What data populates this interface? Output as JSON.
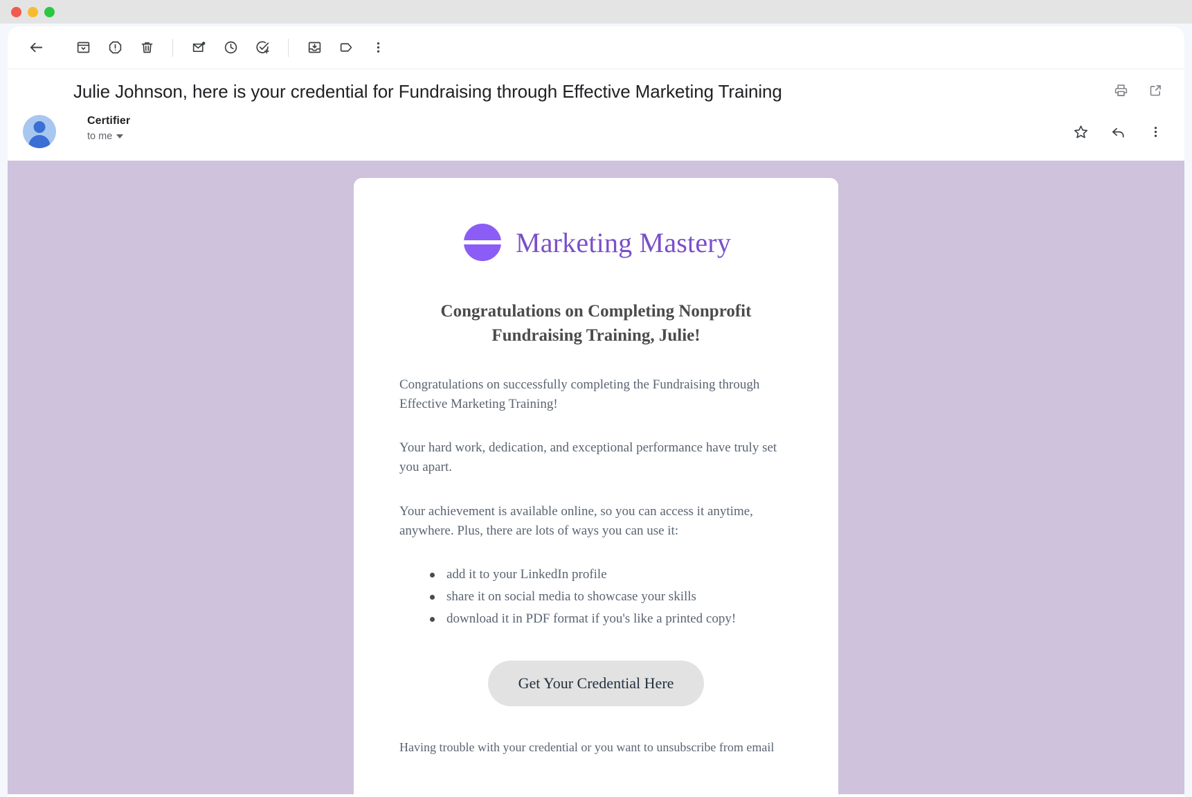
{
  "window": {
    "traffic_lights": [
      {
        "name": "close-button",
        "color": "#f05a4f"
      },
      {
        "name": "minimize-button",
        "color": "#f7bc2e"
      },
      {
        "name": "maximize-button",
        "color": "#28c840"
      }
    ]
  },
  "toolbar": {
    "buttons": [
      {
        "name": "back-to-inbox-button",
        "icon": "arrow-back-icon",
        "label": "Back to inbox"
      },
      {
        "name": "archive-button",
        "icon": "archive-icon",
        "label": "Archive"
      },
      {
        "name": "report-spam-button",
        "icon": "report-spam-icon",
        "label": "Report spam"
      },
      {
        "name": "delete-button",
        "icon": "trash-icon",
        "label": "Delete"
      },
      {
        "name": "mark-unread-button",
        "icon": "mark-unread-icon",
        "label": "Mark as unread"
      },
      {
        "name": "snooze-button",
        "icon": "clock-icon",
        "label": "Snooze"
      },
      {
        "name": "add-to-tasks-button",
        "icon": "add-task-icon",
        "label": "Add to tasks"
      },
      {
        "name": "move-to-button",
        "icon": "move-to-inbox-icon",
        "label": "Move to"
      },
      {
        "name": "labels-button",
        "icon": "label-icon",
        "label": "Labels"
      },
      {
        "name": "more-options-button",
        "icon": "more-vertical-icon",
        "label": "More"
      }
    ]
  },
  "subject": {
    "title": "Julie Johnson, here is your credential for Fundraising through Effective Marketing Training",
    "actions": [
      {
        "name": "print-button",
        "icon": "printer-icon",
        "label": "Print all"
      },
      {
        "name": "open-in-new-window-button",
        "icon": "open-in-new-icon",
        "label": "Open in new window"
      }
    ]
  },
  "message": {
    "sender_name": "Certifier",
    "recipient": "to me",
    "actions": [
      {
        "name": "star-button",
        "icon": "star-outline-icon",
        "label": "Star"
      },
      {
        "name": "reply-button",
        "icon": "reply-icon",
        "label": "Reply"
      },
      {
        "name": "message-more-button",
        "icon": "more-vertical-icon",
        "label": "More"
      }
    ]
  },
  "email": {
    "canvas_color": "#cec2dc",
    "brand": {
      "name": "Marketing Mastery",
      "mark": "purple-circle-logo-icon",
      "color": "#7b4fc9",
      "mark_color": "#8b5cf6"
    },
    "heading": "Congratulations on Completing Nonprofit Fundraising Training, Julie!",
    "paragraphs": [
      "Congratulations on successfully completing the Fundraising through Effective Marketing Training!",
      "Your hard work, dedication, and exceptional performance have truly set you apart.",
      "Your achievement is available online, so you can access it anytime, anywhere. Plus, there are lots of ways you can use it:"
    ],
    "bullets": [
      "add it to your LinkedIn profile",
      "share it on social media to showcase your skills",
      "download it in PDF format if you's like a printed copy!"
    ],
    "cta_label": "Get Your Credential Here",
    "footer_note": "Having trouble with your credential or you want to unsubscribe from email"
  }
}
